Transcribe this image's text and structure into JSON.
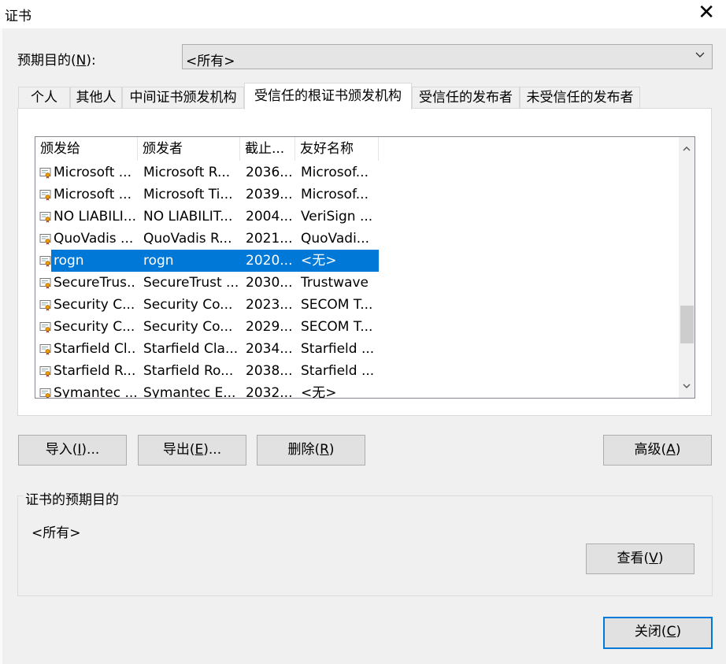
{
  "window": {
    "title": "证书",
    "close_glyph": "✕"
  },
  "purpose": {
    "label_pre": "预期目的(",
    "label_mnemonic": "N",
    "label_post": "):",
    "value": "<所有>"
  },
  "tabs": [
    {
      "label": "个人",
      "active": false
    },
    {
      "label": "其他人",
      "active": false
    },
    {
      "label": "中间证书颁发机构",
      "active": false
    },
    {
      "label": "受信任的根证书颁发机构",
      "active": true
    },
    {
      "label": "受信任的发布者",
      "active": false
    },
    {
      "label": "未受信任的发布者",
      "active": false
    }
  ],
  "list": {
    "columns": [
      "颁发给",
      "颁发者",
      "截止...",
      "友好名称"
    ],
    "rows": [
      {
        "issued_to": "Microsoft ...",
        "issued_by": "Microsoft R...",
        "expires": "2036...",
        "friendly": "Microsof...",
        "selected": false
      },
      {
        "issued_to": "Microsoft ...",
        "issued_by": "Microsoft Ti...",
        "expires": "2039...",
        "friendly": "Microsof...",
        "selected": false
      },
      {
        "issued_to": "NO LIABILI...",
        "issued_by": "NO LIABILIT...",
        "expires": "2004...",
        "friendly": "VeriSign ...",
        "selected": false
      },
      {
        "issued_to": "QuoVadis ...",
        "issued_by": "QuoVadis R...",
        "expires": "2021...",
        "friendly": "QuoVadi...",
        "selected": false
      },
      {
        "issued_to": "rogn",
        "issued_by": "rogn",
        "expires": "2020...",
        "friendly": "<无>",
        "selected": true
      },
      {
        "issued_to": "SecureTrus...",
        "issued_by": "SecureTrust ...",
        "expires": "2030...",
        "friendly": "Trustwave",
        "selected": false
      },
      {
        "issued_to": "Security C...",
        "issued_by": "Security Co...",
        "expires": "2023...",
        "friendly": "SECOM T...",
        "selected": false
      },
      {
        "issued_to": "Security C...",
        "issued_by": "Security Co...",
        "expires": "2029...",
        "friendly": "SECOM T...",
        "selected": false
      },
      {
        "issued_to": "Starfield Cl...",
        "issued_by": "Starfield Cla...",
        "expires": "2034...",
        "friendly": "Starfield ...",
        "selected": false
      },
      {
        "issued_to": "Starfield R...",
        "issued_by": "Starfield Ro...",
        "expires": "2038...",
        "friendly": "Starfield ...",
        "selected": false
      },
      {
        "issued_to": "Symantec ...",
        "issued_by": "Symantec E...",
        "expires": "2032...",
        "friendly": "<无>",
        "selected": false
      }
    ]
  },
  "buttons": {
    "import": {
      "pre": "导入(",
      "mn": "I",
      "post": ")..."
    },
    "export": {
      "pre": "导出(",
      "mn": "E",
      "post": ")..."
    },
    "remove": {
      "pre": "删除(",
      "mn": "R",
      "post": ")"
    },
    "advanced": {
      "pre": "高级(",
      "mn": "A",
      "post": ")"
    },
    "view": {
      "pre": "查看(",
      "mn": "V",
      "post": ")"
    },
    "close": {
      "pre": "关闭(",
      "mn": "C",
      "post": ")"
    }
  },
  "purposes_group": {
    "legend": "证书的预期目的",
    "value": "<所有>"
  },
  "colors": {
    "selection": "#0078d7",
    "default_button_border": "#0078d7",
    "dialog_bg": "#f0f0f0"
  }
}
